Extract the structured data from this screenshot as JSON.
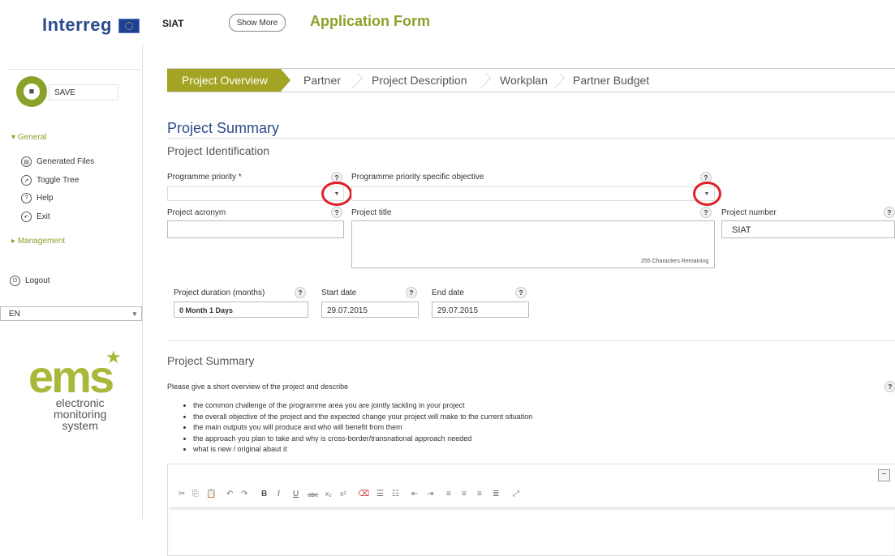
{
  "header": {
    "logo": "Interreg",
    "app_code": "SIAT",
    "show_more": "Show More",
    "title": "Application Form"
  },
  "sidebar": {
    "save_label": "SAVE",
    "general": "General",
    "items": [
      {
        "label": "Generated Files",
        "icon": "save-icon"
      },
      {
        "label": "Toggle Tree",
        "icon": "tree-icon"
      },
      {
        "label": "Help",
        "icon": "help-icon"
      },
      {
        "label": "Exit",
        "icon": "exit-icon"
      }
    ],
    "management": "Management",
    "logout": "Logout",
    "language": "EN",
    "ems_logo": "ems",
    "ems_line1": "electronic",
    "ems_line2": "monitoring",
    "ems_line3": "system"
  },
  "steps": [
    "Project Overview",
    "Partner",
    "Project Description",
    "Workplan",
    "Partner Budget"
  ],
  "main": {
    "heading": "Project Summary",
    "subheading": "Project Identification",
    "fields": {
      "priority_label": "Programme priority *",
      "objective_label": "Programme priority specific objective",
      "acronym_label": "Project acronym",
      "title_label": "Project title",
      "number_label": "Project number",
      "number_value": "SIAT",
      "chars_remaining": "255 Characters Remaining",
      "duration_label": "Project duration (months)",
      "duration_value": "0 Month 1 Days",
      "start_label": "Start date",
      "start_value": "29.07.2015",
      "end_label": "End date",
      "end_value": "29.07.2015"
    },
    "summary_heading": "Project Summary",
    "summary_intro": "Please give a short overview of the project and describe",
    "bullets": [
      "the common challenge of the programme area you are jointly tackling in your project",
      "the overall objective of the project and the expected change your project will make to the current situation",
      "the main outputs you will produce and who will benefit from them",
      "the approach you plan to take and why is cross-border/transnational approach needed",
      "what is new / original abaut it"
    ],
    "help_symbol": "?"
  },
  "colors": {
    "accent": "#8aa22a",
    "step_active": "#a3a423",
    "heading": "#2b4c8c",
    "highlight": "#e01f26"
  }
}
